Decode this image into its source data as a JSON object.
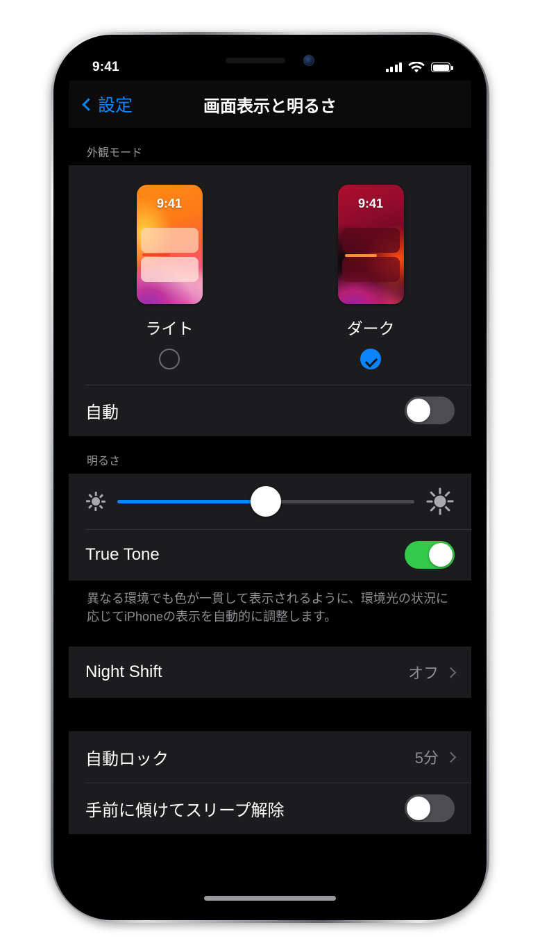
{
  "status_bar": {
    "time": "9:41",
    "signal_icon": "cellular-bars-icon",
    "wifi_icon": "wifi-icon",
    "battery_icon": "battery-full-icon"
  },
  "nav": {
    "back_label": "設定",
    "back_icon": "chevron-left-icon",
    "title": "画面表示と明るさ"
  },
  "appearance_section": {
    "header": "外観モード",
    "options": [
      {
        "label": "ライト",
        "preview_time": "9:41",
        "selected": false
      },
      {
        "label": "ダーク",
        "preview_time": "9:41",
        "selected": true
      }
    ],
    "auto_row": {
      "label": "自動",
      "toggle_state": "off"
    }
  },
  "brightness_section": {
    "header": "明るさ",
    "slider": {
      "value_percent": 50,
      "low_icon": "sun-small-icon",
      "high_icon": "sun-large-icon",
      "fill_color": "#0A84FF"
    },
    "true_tone_row": {
      "label": "True Tone",
      "toggle_state": "on",
      "toggle_color": "#34C94A"
    },
    "footnote": "異なる環境でも色が一貫して表示されるように、環境光の状況に応じてiPhoneの表示を自動的に調整します。"
  },
  "night_shift_section": {
    "row": {
      "label": "Night Shift",
      "value": "オフ",
      "chevron_icon": "chevron-right-icon"
    }
  },
  "lock_section": {
    "auto_lock_row": {
      "label": "自動ロック",
      "value": "5分",
      "chevron_icon": "chevron-right-icon"
    },
    "raise_to_wake_row": {
      "label": "手前に傾けてスリープ解除",
      "toggle_state": "off"
    }
  },
  "theme": {
    "accent_blue": "#0A84FF",
    "card_background": "#1C1C1E",
    "screen_background": "#000000",
    "secondary_text": "#8E8E93"
  }
}
